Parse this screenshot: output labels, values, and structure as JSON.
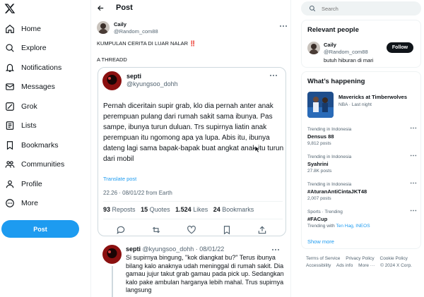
{
  "nav": {
    "items": [
      {
        "label": "Home",
        "icon": "home-icon"
      },
      {
        "label": "Explore",
        "icon": "search-icon"
      },
      {
        "label": "Notifications",
        "icon": "bell-icon"
      },
      {
        "label": "Messages",
        "icon": "envelope-icon"
      },
      {
        "label": "Grok",
        "icon": "grok-icon"
      },
      {
        "label": "Lists",
        "icon": "list-icon"
      },
      {
        "label": "Bookmarks",
        "icon": "bookmark-icon"
      },
      {
        "label": "Communities",
        "icon": "people-icon"
      },
      {
        "label": "Profile",
        "icon": "person-icon"
      },
      {
        "label": "More",
        "icon": "more-circle-icon"
      }
    ],
    "post_button": "Post"
  },
  "header": {
    "title": "Post"
  },
  "tweet": {
    "author_name": "Caily",
    "author_handle": "@Random_com88",
    "text_line1": "KUMPULAN CERITA DI LUAR NALAR ‼️",
    "text_line2": "A THREADD"
  },
  "quoted": {
    "name": "septi",
    "handle": "@kyungsoo_dohh",
    "body": "Pernah diceritain supir grab, klo dia pernah anter anak perempuan pulang dari rumah sakit sama ibunya. Pas sampe, ibunya turun duluan. Trs supirnya liatin anak perempuan itu ngomong apa ya lupa. Abis itu, ibunya dateng lagi sama bapak-bapak buat angkat anak itu turun dari mobil",
    "translate": "Translate post",
    "timestamp": "22.26 · 08/01/22 from Earth",
    "reposts": "93",
    "reposts_label": "Reposts",
    "quotes": "15",
    "quotes_label": "Quotes",
    "likes": "1.524",
    "likes_label": "Likes",
    "bookmarks": "24",
    "bookmarks_label": "Bookmarks"
  },
  "reply": {
    "name": "septi",
    "handle_date": "@kyungsoo_dohh · 08/01/22",
    "body": "Si supirnya bingung, \"kok diangkat bu?\" Terus ibunya bilang kalo anaknya udah meninggal di rumah sakit. Dia gamau jujur takut grab gamau pada pick up. Sedangkan kalo pake ambulan harganya lebih mahal. Trus supirnya langsung"
  },
  "search": {
    "placeholder": "Search"
  },
  "relevant": {
    "title": "Relevant people",
    "name": "Caily",
    "handle": "@Random_com88",
    "bio": "butuh hiburan di mari",
    "follow": "Follow"
  },
  "happening": {
    "title": "What’s happening",
    "event_title": "Mavericks at Timberwolves",
    "event_meta": "NBA · Last night",
    "trends": [
      {
        "context": "Trending in Indonesia",
        "name": "Densus 88",
        "posts": "9,812 posts"
      },
      {
        "context": "Trending in Indonesia",
        "name": "Syahrini",
        "posts": "27.8K posts"
      },
      {
        "context": "Trending in Indonesia",
        "name": "#AturanAntiCintaJKT48",
        "posts": "2,007 posts"
      },
      {
        "context": "Sports · Trending",
        "name": "#FACup",
        "posts_prefix": "Trending with",
        "posts_links": "Ten Hag, INEOS"
      }
    ],
    "show_more": "Show more"
  },
  "footer": {
    "row1": [
      "Terms of Service",
      "Privacy Policy",
      "Cookie Policy"
    ],
    "row2": [
      "Accessibility",
      "Ads info",
      "More ···",
      "© 2024 X Corp."
    ]
  },
  "colors": {
    "accent": "#1d9bf0",
    "text": "#0f1419",
    "muted": "#536471",
    "border": "#eff3f4"
  }
}
